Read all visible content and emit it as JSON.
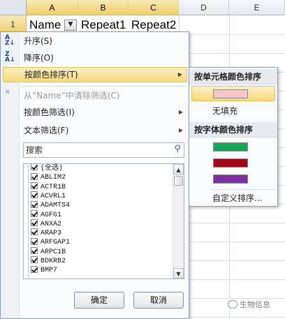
{
  "sheet": {
    "columns": [
      "A",
      "B",
      "C",
      "D",
      "E"
    ],
    "row_number": "1",
    "cells": [
      "Name",
      "Repeat1",
      "Repeat2"
    ],
    "filter_button_icon": "dropdown-arrow-icon"
  },
  "menu": {
    "sort_ascending": "升序(S)",
    "sort_descending": "降序(O)",
    "sort_by_color": "按颜色排序(T)",
    "clear_filter": "从“Name”中清除筛选(C)",
    "filter_by_color": "按颜色筛选(I)",
    "text_filters": "文本筛选(F)"
  },
  "search": {
    "placeholder": "搜索"
  },
  "list_items": [
    "(全选)",
    "ABLIM2",
    "ACTR1B",
    "ACVRL1",
    "ADAMTS4",
    "AGFG1",
    "ANXA2",
    "ARAP3",
    "ARFGAP1",
    "ARPC1B",
    "BDKRB2",
    "BMP7"
  ],
  "buttons": {
    "ok": "确定",
    "cancel": "取消"
  },
  "submenu": {
    "cell_color_header": "按单元格颜色排序",
    "no_fill": "无填充",
    "font_color_header": "按字体颜色排序",
    "custom_sort": "自定义排序..."
  },
  "colors": {
    "cell_color_pink": "#f8c5cb",
    "font_color_green": "#17a557",
    "font_color_darkred": "#9c0a1a",
    "font_color_purple": "#7b2fa0",
    "highlight": "#f8d97d",
    "header_selected": "#f1cd6b"
  },
  "watermark": "生物信息"
}
